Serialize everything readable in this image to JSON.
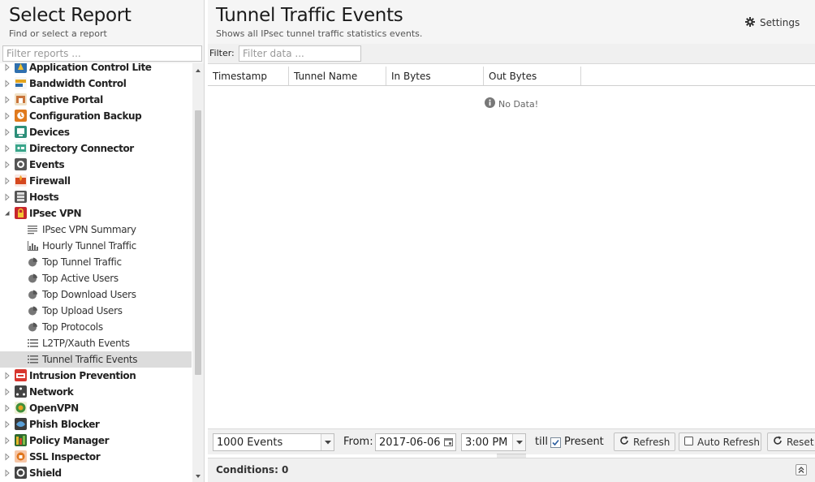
{
  "left_panel": {
    "title": "Select Report",
    "subtitle": "Find or select a report",
    "filter_placeholder": "Filter reports ...",
    "categories_before": [
      {
        "label": "Application Control Lite",
        "icon": "app-control-lite-icon"
      },
      {
        "label": "Bandwidth Control",
        "icon": "bandwidth-control-icon"
      },
      {
        "label": "Captive Portal",
        "icon": "captive-portal-icon"
      },
      {
        "label": "Configuration Backup",
        "icon": "configuration-backup-icon"
      },
      {
        "label": "Devices",
        "icon": "devices-icon"
      },
      {
        "label": "Directory Connector",
        "icon": "directory-connector-icon"
      },
      {
        "label": "Events",
        "icon": "events-icon"
      },
      {
        "label": "Firewall",
        "icon": "firewall-icon"
      },
      {
        "label": "Hosts",
        "icon": "hosts-icon"
      }
    ],
    "expanded_category": {
      "label": "IPsec VPN",
      "icon": "ipsec-vpn-icon"
    },
    "reports": [
      {
        "label": "IPsec VPN Summary",
        "icon": "text-report-icon"
      },
      {
        "label": "Hourly Tunnel Traffic",
        "icon": "bar-chart-icon"
      },
      {
        "label": "Top Tunnel Traffic",
        "icon": "pie-chart-icon"
      },
      {
        "label": "Top Active Users",
        "icon": "pie-chart-icon"
      },
      {
        "label": "Top Download Users",
        "icon": "pie-chart-icon"
      },
      {
        "label": "Top Upload Users",
        "icon": "pie-chart-icon"
      },
      {
        "label": "Top Protocols",
        "icon": "pie-chart-icon"
      },
      {
        "label": "L2TP/Xauth Events",
        "icon": "event-list-icon"
      },
      {
        "label": "Tunnel Traffic Events",
        "icon": "event-list-icon",
        "selected": true
      }
    ],
    "categories_after": [
      {
        "label": "Intrusion Prevention",
        "icon": "intrusion-prevention-icon"
      },
      {
        "label": "Network",
        "icon": "network-icon"
      },
      {
        "label": "OpenVPN",
        "icon": "openvpn-icon"
      },
      {
        "label": "Phish Blocker",
        "icon": "phish-blocker-icon"
      },
      {
        "label": "Policy Manager",
        "icon": "policy-manager-icon"
      },
      {
        "label": "SSL Inspector",
        "icon": "ssl-inspector-icon"
      },
      {
        "label": "Shield",
        "icon": "shield-icon"
      }
    ]
  },
  "report": {
    "title": "Tunnel Traffic Events",
    "subtitle": "Shows all IPsec tunnel traffic statistics events.",
    "settings_label": "Settings",
    "filter_label": "Filter:",
    "filter_placeholder": "Filter data ...",
    "columns": [
      "Timestamp",
      "Tunnel Name",
      "In Bytes",
      "Out Bytes"
    ],
    "empty_text": "No Data!"
  },
  "toolbar": {
    "events_limit": "1000 Events",
    "from_label": "From:",
    "from_date": "2017-06-06",
    "from_time": "3:00 PM",
    "till_label": "till",
    "present_label": "Present",
    "present_checked": true,
    "refresh_label": "Refresh",
    "auto_refresh_label": "Auto Refresh",
    "reset_label": "Reset"
  },
  "conditions": {
    "label": "Conditions: 0"
  },
  "colors": {
    "header_bg": "#f5f5f5",
    "toolbar_bg": "#f0f0f0",
    "selected_row": "#dcdcdc"
  }
}
